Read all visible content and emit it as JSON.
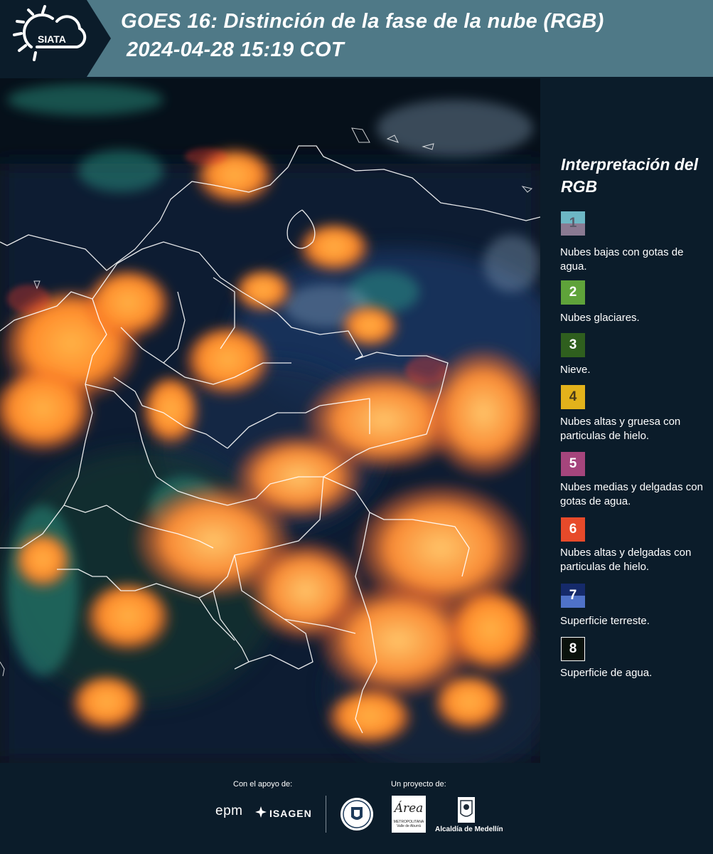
{
  "header": {
    "logo_text": "SIATA",
    "title_line1": "GOES 16: Distinción de la fase de la nube (RGB)",
    "title_line2": "2024-04-28 15:19 COT"
  },
  "legend": {
    "title": "Interpretación del RGB",
    "items": [
      {
        "number": "1",
        "label": "Nubes bajas con gotas de agua.",
        "color_top": "#6db7c5",
        "color_bottom": "#8a7a92",
        "text_color": "#5a5a6a"
      },
      {
        "number": "2",
        "label": "Nubes glaciares.",
        "color_top": "#5fa33a",
        "color_bottom": "#5fa33a",
        "text_color": "#ffffff"
      },
      {
        "number": "3",
        "label": "Nieve.",
        "color_top": "#2f5f1e",
        "color_bottom": "#2f5f1e",
        "text_color": "#ffffff"
      },
      {
        "number": "4",
        "label": "Nubes altas y gruesa con particulas de hielo.",
        "color_top": "#e3b21b",
        "color_bottom": "#e3b21b",
        "text_color": "#4a3a1a"
      },
      {
        "number": "5",
        "label": "Nubes medias y delgadas con gotas de agua.",
        "color_top": "#a5457c",
        "color_bottom": "#a5457c",
        "text_color": "#ffffff"
      },
      {
        "number": "6",
        "label": "Nubes altas y delgadas con particulas de hielo.",
        "color_top": "#e74a2a",
        "color_bottom": "#e74a2a",
        "text_color": "#ffffff"
      },
      {
        "number": "7",
        "label": "Superficie terreste.",
        "color_top": "#152a6a",
        "color_bottom": "#4f72c8",
        "text_color": "#ffffff"
      },
      {
        "number": "8",
        "label": "Superficie de agua.",
        "color_top": "#0a120c",
        "color_bottom": "#0a120c",
        "text_color": "#ffffff"
      }
    ]
  },
  "footer": {
    "support_label": "Con el apoyo de:",
    "project_label": "Un proyecto de:",
    "epm_text": "epm",
    "isagen_text": "ISAGEN",
    "area_text": "Área",
    "area_subtext": "METROPOLITANA Valle de Aburrá",
    "alcaldia_text": "Alcaldía de Medellín"
  }
}
